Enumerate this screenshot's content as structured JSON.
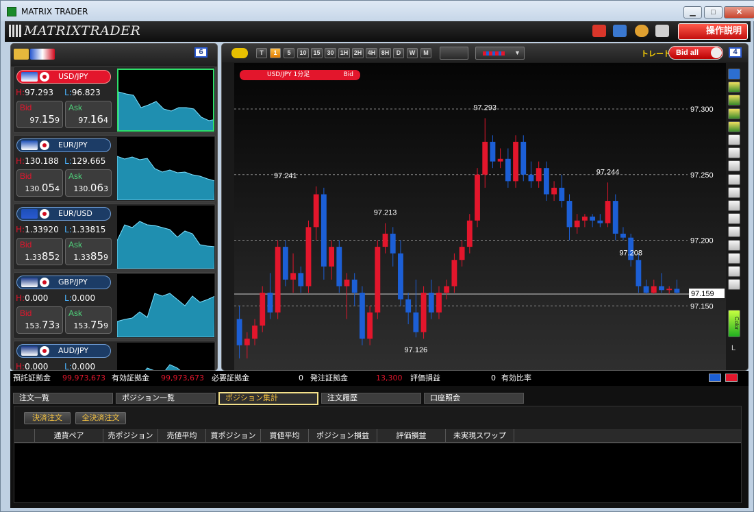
{
  "window": {
    "title": "MATRIX TRADER",
    "min": "▁",
    "max": "□",
    "close": "✕"
  },
  "toolbar": {
    "logo": "MATRIXTRADER",
    "help": "操作説明"
  },
  "left": {
    "count": "6"
  },
  "pairs": [
    {
      "name": "USD/JPY",
      "h": "97.293",
      "l": "96.823",
      "bid_a": "97.",
      "bid_b": "15",
      "bid_c": "9",
      "ask_a": "97.",
      "ask_b": "16",
      "ask_c": "4",
      "active": true
    },
    {
      "name": "EUR/JPY",
      "h": "130.188",
      "l": "129.665",
      "bid_a": "130.",
      "bid_b": "05",
      "bid_c": "4",
      "ask_a": "130.",
      "ask_b": "06",
      "ask_c": "3"
    },
    {
      "name": "EUR/USD",
      "h": "1.33920",
      "l": "1.33815",
      "bid_a": "1.33",
      "bid_b": "85",
      "bid_c": "2",
      "ask_a": "1.33",
      "ask_b": "85",
      "ask_c": "9"
    },
    {
      "name": "GBP/JPY",
      "h": "0.000",
      "l": "0.000",
      "bid_a": "153.",
      "bid_b": "73",
      "bid_c": "3",
      "ask_a": "153.",
      "ask_b": "75",
      "ask_c": "9"
    },
    {
      "name": "AUD/JPY",
      "h": "0.000",
      "l": "0.000",
      "bid_a": "",
      "bid_b": "",
      "bid_c": "",
      "ask_a": "",
      "ask_b": "",
      "ask_c": ""
    }
  ],
  "labels": {
    "h": "H:",
    "l": "L:",
    "bid": "Bid",
    "ask": "Ask"
  },
  "chart": {
    "timeframes": [
      "T",
      "1",
      "5",
      "10",
      "15",
      "30",
      "1H",
      "2H",
      "4H",
      "8H",
      "D",
      "W",
      "M"
    ],
    "active_tf": "1",
    "trade_label": "トレード",
    "bid_all": "Bid all",
    "count": "4",
    "tag": "USD/JPY 1分足",
    "tag_bid": "Bid",
    "ticks": [
      "97.300",
      "97.250",
      "97.200",
      "97.150"
    ],
    "current": "97.159",
    "annotations": [
      "97.293",
      "97.241",
      "97.213",
      "97.244",
      "97.208",
      "97.126"
    ],
    "side_l": "L",
    "color_btn": "Color"
  },
  "chart_data": {
    "type": "candlestick",
    "title": "USD/JPY 1分足",
    "ylim": [
      97.1,
      97.335
    ],
    "ticks": [
      97.3,
      97.25,
      97.2,
      97.15
    ],
    "current": 97.159,
    "colors": {
      "up": "#e3162c",
      "down": "#1c5fd6",
      "doji": "#e8c000"
    },
    "candles": [
      [
        97.14,
        97.15,
        97.11,
        97.12
      ],
      [
        97.12,
        97.13,
        97.11,
        97.125
      ],
      [
        97.125,
        97.14,
        97.12,
        97.135
      ],
      [
        97.135,
        97.165,
        97.13,
        97.16
      ],
      [
        97.16,
        97.175,
        97.14,
        97.145
      ],
      [
        97.145,
        97.2,
        97.14,
        97.195
      ],
      [
        97.195,
        97.2,
        97.165,
        97.17
      ],
      [
        97.17,
        97.19,
        97.16,
        97.175
      ],
      [
        97.175,
        97.18,
        97.16,
        97.165
      ],
      [
        97.165,
        97.215,
        97.16,
        97.21
      ],
      [
        97.21,
        97.241,
        97.2,
        97.235
      ],
      [
        97.235,
        97.24,
        97.17,
        97.18
      ],
      [
        97.18,
        97.2,
        97.17,
        97.195
      ],
      [
        97.195,
        97.2,
        97.16,
        97.165
      ],
      [
        97.165,
        97.175,
        97.14,
        97.17
      ],
      [
        97.17,
        97.175,
        97.15,
        97.16
      ],
      [
        97.16,
        97.165,
        97.12,
        97.125
      ],
      [
        97.125,
        97.15,
        97.12,
        97.145
      ],
      [
        97.145,
        97.2,
        97.14,
        97.195
      ],
      [
        97.195,
        97.213,
        97.19,
        97.205
      ],
      [
        97.205,
        97.21,
        97.18,
        97.19
      ],
      [
        97.19,
        97.2,
        97.15,
        97.155
      ],
      [
        97.155,
        97.16,
        97.136,
        97.145
      ],
      [
        97.145,
        97.17,
        97.126,
        97.13
      ],
      [
        97.13,
        97.165,
        97.125,
        97.16
      ],
      [
        97.16,
        97.17,
        97.14,
        97.145
      ],
      [
        97.145,
        97.165,
        97.14,
        97.16
      ],
      [
        97.16,
        97.17,
        97.155,
        97.165
      ],
      [
        97.165,
        97.19,
        97.16,
        97.185
      ],
      [
        97.185,
        97.2,
        97.18,
        97.195
      ],
      [
        97.195,
        97.22,
        97.19,
        97.215
      ],
      [
        97.215,
        97.255,
        97.21,
        97.25
      ],
      [
        97.25,
        97.293,
        97.24,
        97.275
      ],
      [
        97.275,
        97.28,
        97.255,
        97.26
      ],
      [
        97.26,
        97.27,
        97.255,
        97.262
      ],
      [
        97.262,
        97.27,
        97.24,
        97.245
      ],
      [
        97.245,
        97.28,
        97.24,
        97.275
      ],
      [
        97.275,
        97.28,
        97.245,
        97.25
      ],
      [
        97.25,
        97.26,
        97.24,
        97.245
      ],
      [
        97.245,
        97.26,
        97.24,
        97.255
      ],
      [
        97.255,
        97.26,
        97.23,
        97.235
      ],
      [
        97.235,
        97.245,
        97.23,
        97.24
      ],
      [
        97.24,
        97.25,
        97.225,
        97.23
      ],
      [
        97.23,
        97.235,
        97.2,
        97.21
      ],
      [
        97.21,
        97.22,
        97.205,
        97.215
      ],
      [
        97.215,
        97.22,
        97.21,
        97.218
      ],
      [
        97.218,
        97.22,
        97.21,
        97.215
      ],
      [
        97.215,
        97.22,
        97.21,
        97.213
      ],
      [
        97.213,
        97.244,
        97.21,
        97.23
      ],
      [
        97.23,
        97.235,
        97.2,
        97.205
      ],
      [
        97.205,
        97.21,
        97.2,
        97.202
      ],
      [
        97.202,
        97.205,
        97.18,
        97.185
      ],
      [
        97.185,
        97.19,
        97.16,
        97.165
      ],
      [
        97.165,
        97.17,
        97.159,
        97.16
      ],
      [
        97.16,
        97.17,
        97.159,
        97.165
      ],
      [
        97.165,
        97.175,
        97.16,
        97.162
      ],
      [
        97.162,
        97.165,
        97.159,
        97.163
      ],
      [
        97.163,
        97.17,
        97.159,
        97.16
      ]
    ]
  },
  "account": {
    "deposit_l": "預託証拠金",
    "deposit_v": "99,973,673",
    "effective_l": "有効証拠金",
    "effective_v": "99,973,673",
    "required_l": "必要証拠金",
    "required_v": "0",
    "order_l": "発注証拠金",
    "order_v": "13,300",
    "eval_l": "評価損益",
    "eval_v": "0",
    "ratio_l": "有効比率"
  },
  "tabs": [
    "注文一覧",
    "ポジション一覧",
    "ポジション集計",
    "注文履歴",
    "口座照会"
  ],
  "panel": {
    "settle": "決済注文",
    "settle_all": "全決済注文",
    "columns": [
      "",
      "通貨ペア",
      "売ポジション",
      "売値平均",
      "買ポジション",
      "買値平均",
      "ポジション損益",
      "評価損益",
      "未実現スワップ"
    ]
  }
}
